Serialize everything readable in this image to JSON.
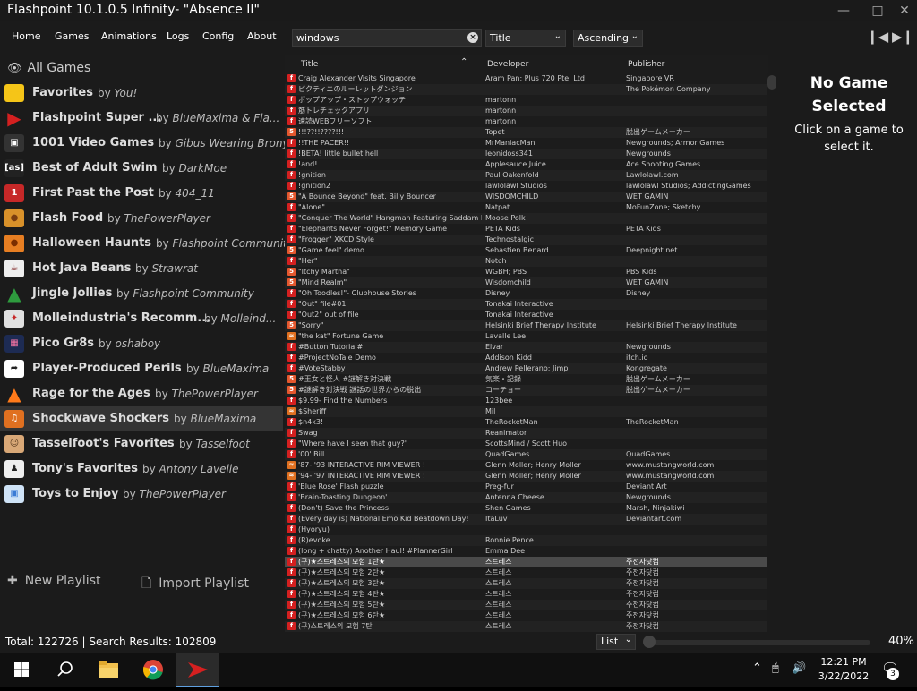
{
  "window": {
    "title": "Flashpoint 10.1.0.5 Infinity- \"Absence II\""
  },
  "menu": [
    "Home",
    "Games",
    "Animations",
    "Logs",
    "Config",
    "About"
  ],
  "search": {
    "value": "windows"
  },
  "sort": {
    "field": "Title",
    "order": "Ascending"
  },
  "sidebar": {
    "all_games": "All Games",
    "playlists": [
      {
        "name": "Favorites",
        "author": "You!",
        "icon": "star-icon"
      },
      {
        "name": "Flashpoint Super ...",
        "author": "BlueMaxima & Fla...",
        "icon": "flashpoint-logo-icon"
      },
      {
        "name": "1001 Video Games",
        "author": "Gibus Wearing Brony",
        "icon": "space-invader-icon"
      },
      {
        "name": "Best of Adult Swim",
        "author": "DarkMoe",
        "icon": "adult-swim-icon"
      },
      {
        "name": "First Past the Post",
        "author": "404_11",
        "icon": "number-one-icon"
      },
      {
        "name": "Flash Food",
        "author": "ThePowerPlayer",
        "icon": "burger-icon"
      },
      {
        "name": "Halloween Haunts",
        "author": "Flashpoint Community",
        "icon": "pumpkin-icon"
      },
      {
        "name": "Hot Java Beans",
        "author": "Strawrat",
        "icon": "coffee-cup-icon"
      },
      {
        "name": "Jingle Jollies",
        "author": "Flashpoint Community",
        "icon": "christmas-tree-icon"
      },
      {
        "name": "Molleindustria's Recomm...",
        "author": "Molleind...",
        "icon": "molleindustria-icon"
      },
      {
        "name": "Pico Gr8s",
        "author": "oshaboy",
        "icon": "pico-8-icon"
      },
      {
        "name": "Player-Produced Perils",
        "author": "BlueMaxima",
        "icon": "share-arrow-icon"
      },
      {
        "name": "Rage for the Ages",
        "author": "ThePowerPlayer",
        "icon": "fire-icon"
      },
      {
        "name": "Shockwave Shockers",
        "author": "BlueMaxima",
        "icon": "shockwave-icon"
      },
      {
        "name": "Tasselfoot's Favorites",
        "author": "Tasselfoot",
        "icon": "tasselfoot-avatar-icon"
      },
      {
        "name": "Tony's Favorites",
        "author": "Antony Lavelle",
        "icon": "tony-avatar-icon"
      },
      {
        "name": "Toys to Enjoy",
        "author": "ThePowerPlayer",
        "icon": "toy-blocks-icon"
      }
    ],
    "by_word": "by",
    "new_playlist": "New Playlist",
    "import_playlist": "Import Playlist"
  },
  "list": {
    "columns": [
      "Title",
      "Developer",
      "Publisher"
    ],
    "rows": [
      {
        "t": "Craig Alexander Visits Singapore",
        "d": "Aram Pan; Plus 720 Pte. Ltd",
        "p": "Singapore VR",
        "i": "flash"
      },
      {
        "t": "ピクティニのルーレットダンジョン",
        "d": "",
        "p": "The Pokémon Company",
        "i": "flash"
      },
      {
        "t": "ポップアップ・ストップウォッチ",
        "d": "martonn",
        "p": "",
        "i": "flash"
      },
      {
        "t": "筋トレチェックアプリ",
        "d": "martonn",
        "p": "",
        "i": "flash"
      },
      {
        "t": "速読WEBフリーソフト",
        "d": "martonn",
        "p": "",
        "i": "flash"
      },
      {
        "t": "!!!??!!????!!!",
        "d": "Topet",
        "p": "脱出ゲームメーカー",
        "i": "html"
      },
      {
        "t": "!!THE PACER!!",
        "d": "MrManiacMan",
        "p": "Newgrounds; Armor Games",
        "i": "flash"
      },
      {
        "t": "!BETA! little bullet hell",
        "d": "leonidoss341",
        "p": "Newgrounds",
        "i": "flash"
      },
      {
        "t": "!and!",
        "d": "Applesauce Juice",
        "p": "Ace Shooting Games",
        "i": "flash"
      },
      {
        "t": "!gnition",
        "d": "Paul Oakenfold",
        "p": "Lawlolawl.com",
        "i": "flash"
      },
      {
        "t": "!gnition2",
        "d": "lawlolawl Studios",
        "p": "lawlolawl Studios; AddictingGames",
        "i": "flash"
      },
      {
        "t": "\"A Bounce Beyond\" feat. Billy Bouncer",
        "d": "WISDOMCHILD",
        "p": "WET GAMIN",
        "i": "html"
      },
      {
        "t": "\"Alone\"",
        "d": "Natpat",
        "p": "MoFunZone; Sketchy",
        "i": "flash"
      },
      {
        "t": "\"Conquer The World\" Hangman Featuring Saddam H...",
        "d": "Moose Polk",
        "p": "",
        "i": "flash"
      },
      {
        "t": "\"Elephants Never Forget!\" Memory Game",
        "d": "PETA Kids",
        "p": "PETA Kids",
        "i": "flash"
      },
      {
        "t": "\"Frogger\" XKCD Style",
        "d": "Technostalgic",
        "p": "",
        "i": "flash"
      },
      {
        "t": "\"Game feel\" demo",
        "d": "Sebastien Benard",
        "p": "Deepnight.net",
        "i": "html"
      },
      {
        "t": "\"Her\"",
        "d": "Notch",
        "p": "",
        "i": "flash"
      },
      {
        "t": "\"Itchy Martha\"",
        "d": "WGBH; PBS",
        "p": "PBS Kids",
        "i": "html"
      },
      {
        "t": "\"Mind Realm\"",
        "d": "Wisdomchild",
        "p": "WET GAMIN",
        "i": "html"
      },
      {
        "t": "\"Oh Toodles!\"- Clubhouse Stories",
        "d": "Disney",
        "p": "Disney",
        "i": "flash"
      },
      {
        "t": "\"Out\" file#01",
        "d": "Tonakai Interactive",
        "p": "",
        "i": "flash"
      },
      {
        "t": "\"Out2\" out of file",
        "d": "Tonakai Interactive",
        "p": "",
        "i": "flash"
      },
      {
        "t": "\"Sorry\"",
        "d": "Helsinki Brief Therapy Institute",
        "p": "Helsinki Brief Therapy Institute",
        "i": "html"
      },
      {
        "t": "\"the kat\" Fortune Game",
        "d": "Lavalle Lee",
        "p": "",
        "i": "sw"
      },
      {
        "t": "#Button Tutorial#",
        "d": "Elvar",
        "p": "Newgrounds",
        "i": "flash"
      },
      {
        "t": "#ProjectNoTale Demo",
        "d": "Addison Kidd",
        "p": "itch.io",
        "i": "flash"
      },
      {
        "t": "#VoteStabby",
        "d": "Andrew Pellerano; Jimp",
        "p": "Kongregate",
        "i": "flash"
      },
      {
        "t": "#王女と怪人 #謎解き対決戦",
        "d": "気楽・記録",
        "p": "脱出ゲームメーカー",
        "i": "html"
      },
      {
        "t": "#謎解き対決戦 謎話の世界からの脱出",
        "d": "コーチョー",
        "p": "脱出ゲームメーカー",
        "i": "html"
      },
      {
        "t": "$9.99- Find the Numbers",
        "d": "123bee",
        "p": "",
        "i": "flash"
      },
      {
        "t": "$Sheriff",
        "d": "Mil",
        "p": "",
        "i": "sw"
      },
      {
        "t": "$n4k3!",
        "d": "TheRocketMan",
        "p": "TheRocketMan",
        "i": "flash"
      },
      {
        "t": "Swag",
        "d": "Reanimator",
        "p": "",
        "i": "flash"
      },
      {
        "t": "\"Where have I seen that guy?\"",
        "d": "ScottsMind / Scott Huo",
        "p": "",
        "i": "flash"
      },
      {
        "t": "'00' Bill",
        "d": "QuadGames",
        "p": "QuadGames",
        "i": "flash"
      },
      {
        "t": "'87- '93 INTERACTIVE RIM VIEWER !",
        "d": "Glenn Moller; Henry Moller",
        "p": "www.mustangworld.com",
        "i": "sw"
      },
      {
        "t": "'94- '97 INTERACTIVE RIM VIEWER !",
        "d": "Glenn Moller; Henry Moller",
        "p": "www.mustangworld.com",
        "i": "sw"
      },
      {
        "t": "'Blue Rose' Flash puzzle",
        "d": "Preg-fur",
        "p": "Deviant Art",
        "i": "flash"
      },
      {
        "t": "'Brain-Toasting Dungeon'",
        "d": "Antenna Cheese",
        "p": "Newgrounds",
        "i": "flash"
      },
      {
        "t": "(Don't) Save the Princess",
        "d": "Shen Games",
        "p": "Marsh, Ninjakiwi",
        "i": "flash"
      },
      {
        "t": "(Every day is) National Emo Kid Beatdown Day!",
        "d": "ItaLuv",
        "p": "Deviantart.com",
        "i": "flash"
      },
      {
        "t": "(Hyoryu)",
        "d": "",
        "p": "",
        "i": "flash"
      },
      {
        "t": "(R)evoke",
        "d": "Ronnie Pence",
        "p": "",
        "i": "flash"
      },
      {
        "t": "(long + chatty) Another Haul! #PlannerGirl",
        "d": "Emma Dee",
        "p": "",
        "i": "flash"
      },
      {
        "t": "(구)★스트레스의 모험 1탄★",
        "d": "스트레스",
        "p": "주전자닷컴",
        "i": "flash"
      },
      {
        "t": "(구)★스트레스의 모험 2탄★",
        "d": "스트레스",
        "p": "주전자닷컴",
        "i": "flash"
      },
      {
        "t": "(구)★스트레스의 모험 3탄★",
        "d": "스트레스",
        "p": "주전자닷컴",
        "i": "flash"
      },
      {
        "t": "(구)★스트레스의 모험 4탄★",
        "d": "스트레스",
        "p": "주전자닷컴",
        "i": "flash"
      },
      {
        "t": "(구)★스트레스의 모험 5탄★",
        "d": "스트레스",
        "p": "주전자닷컴",
        "i": "flash"
      },
      {
        "t": "(구)★스트레스의 모험 6탄★",
        "d": "스트레스",
        "p": "주전자닷컴",
        "i": "flash"
      },
      {
        "t": "(구)스트레스의 모험 7탄",
        "d": "스트레스",
        "p": "주전자닷컴",
        "i": "flash"
      }
    ],
    "highlighted_index": 45
  },
  "details": {
    "heading": "No Game Selected",
    "hint": "Click on a game to select it."
  },
  "status": {
    "text": "Total: 122726  |  Search Results: 102809",
    "view": "List",
    "zoom_fraction": 0.0,
    "zoom_label": "40%"
  },
  "taskbar": {
    "time": "12:21 PM",
    "date": "3/22/2022",
    "notifications": "3"
  },
  "colors": {
    "background": "#1b1b1b",
    "selected_row": "#4a4a4a",
    "flash_icon": "#d42020",
    "taskbar_accent": "#5fa0e0"
  }
}
